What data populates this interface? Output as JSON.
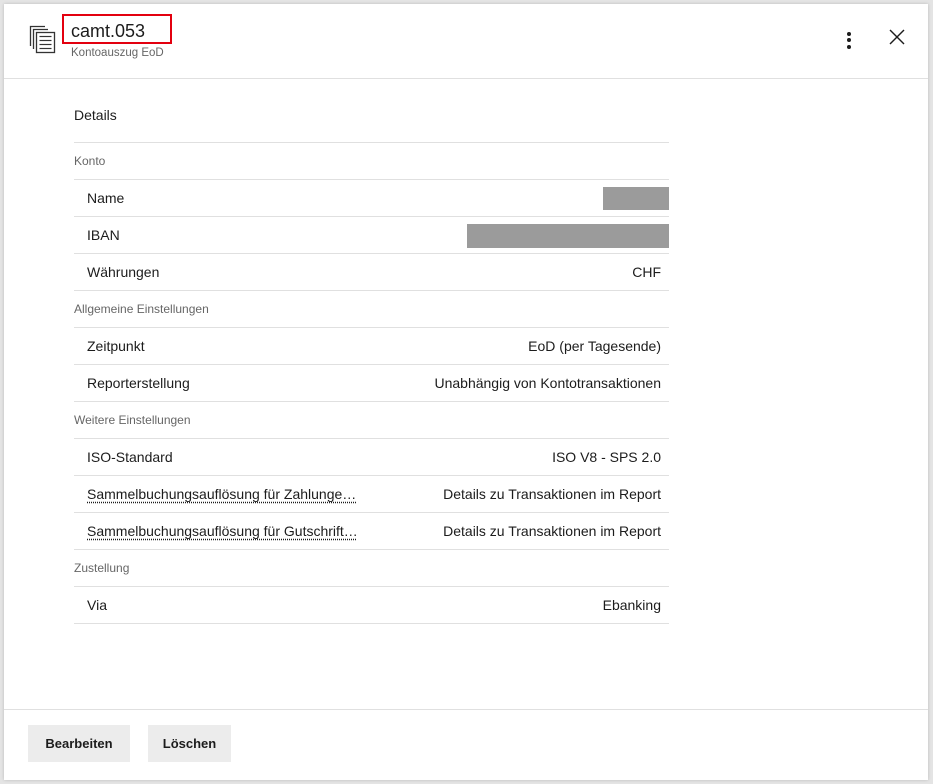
{
  "header": {
    "title": "camt.053",
    "subtitle": "Kontoauszug EoD",
    "icon": "document-stack-icon",
    "menu_icon": "more-vertical-icon",
    "close_icon": "close-icon"
  },
  "annotation": {
    "color": "#e3000f"
  },
  "details": {
    "heading": "Details",
    "sections": [
      {
        "title": "Konto",
        "rows": [
          {
            "label": "Name",
            "redacted": true
          },
          {
            "label": "IBAN",
            "redacted": true
          },
          {
            "label": "Währungen",
            "value": "CHF"
          }
        ]
      },
      {
        "title": "Allgemeine Einstellungen",
        "rows": [
          {
            "label": "Zeitpunkt",
            "value": "EoD (per Tagesende)"
          },
          {
            "label": "Reporterstellung",
            "value": "Unabhängig von Kontotransaktionen"
          }
        ]
      },
      {
        "title": "Weitere Einstellungen",
        "rows": [
          {
            "label": "ISO-Standard",
            "value": "ISO V8 - SPS 2.0"
          },
          {
            "label": "Sammelbuchungsauflösung für Zahlunge…",
            "value": "Details zu Transaktionen im Report"
          },
          {
            "label": "Sammelbuchungsauflösung für Gutschrift…",
            "value": "Details zu Transaktionen im Report"
          }
        ]
      },
      {
        "title": "Zustellung",
        "rows": [
          {
            "label": "Via",
            "value": "Ebanking"
          }
        ]
      }
    ]
  },
  "footer": {
    "edit_label": "Bearbeiten",
    "delete_label": "Löschen"
  }
}
